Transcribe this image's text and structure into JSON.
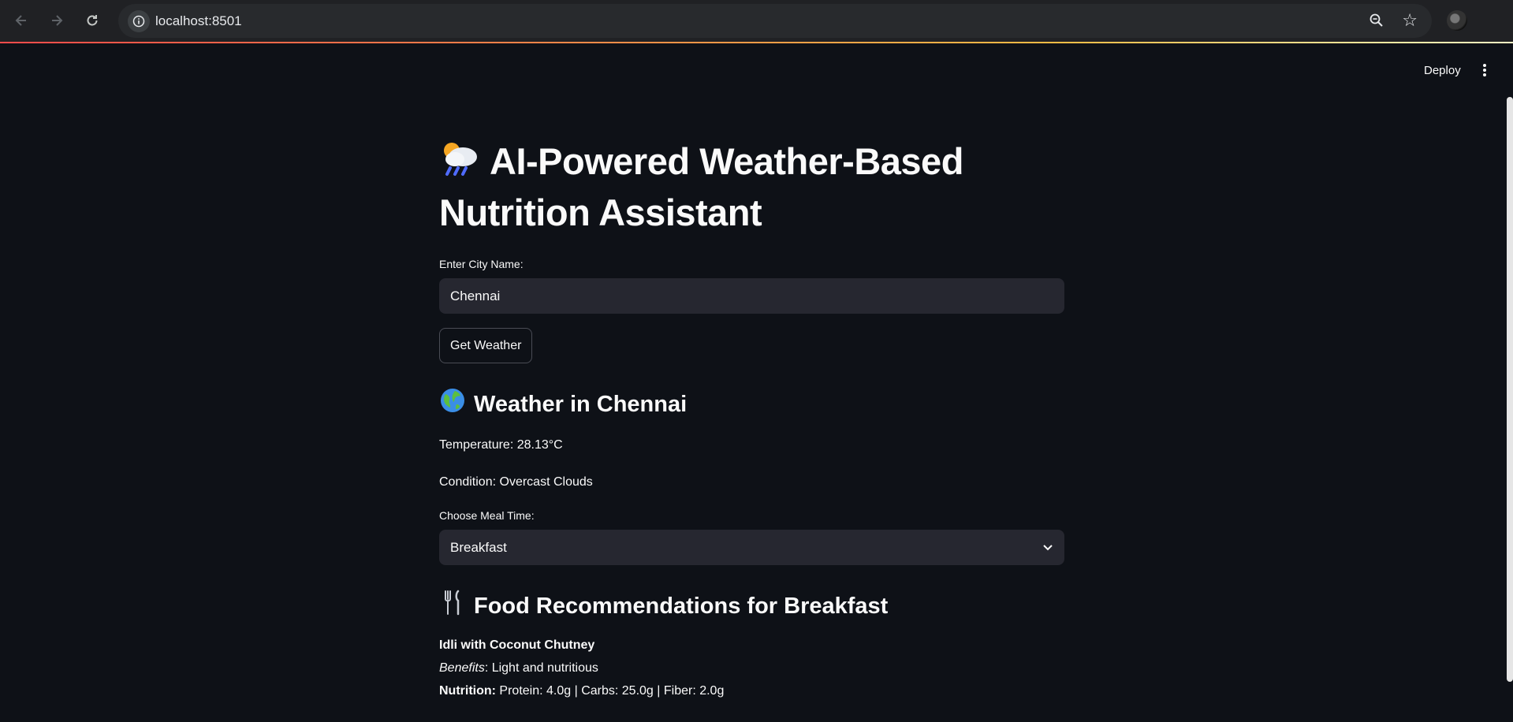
{
  "browser": {
    "url": "localhost:8501"
  },
  "header": {
    "deploy_label": "Deploy"
  },
  "main": {
    "title": "AI-Powered Weather-Based Nutrition Assistant",
    "city_label": "Enter City Name:",
    "city_value": "Chennai",
    "get_weather_label": "Get Weather",
    "weather_heading": "Weather in Chennai",
    "temperature_text": "Temperature: 28.13°C",
    "condition_text": "Condition: Overcast Clouds",
    "meal_label": "Choose Meal Time:",
    "meal_selected": "Breakfast",
    "food_heading": "Food Recommendations for Breakfast",
    "food_item": {
      "name": "Idli with Coconut Chutney",
      "benefits_label": "Benefits",
      "benefits_text": ": Light and nutritious",
      "nutrition_label": "Nutrition:",
      "nutrition_text": " Protein: 4.0g | Carbs: 25.0g | Fiber: 2.0g"
    }
  },
  "icons": {
    "title_emoji": "cloud-with-sun-rain-icon",
    "weather_emoji": "globe-icon",
    "food_emoji": "fork-knife-icon"
  }
}
